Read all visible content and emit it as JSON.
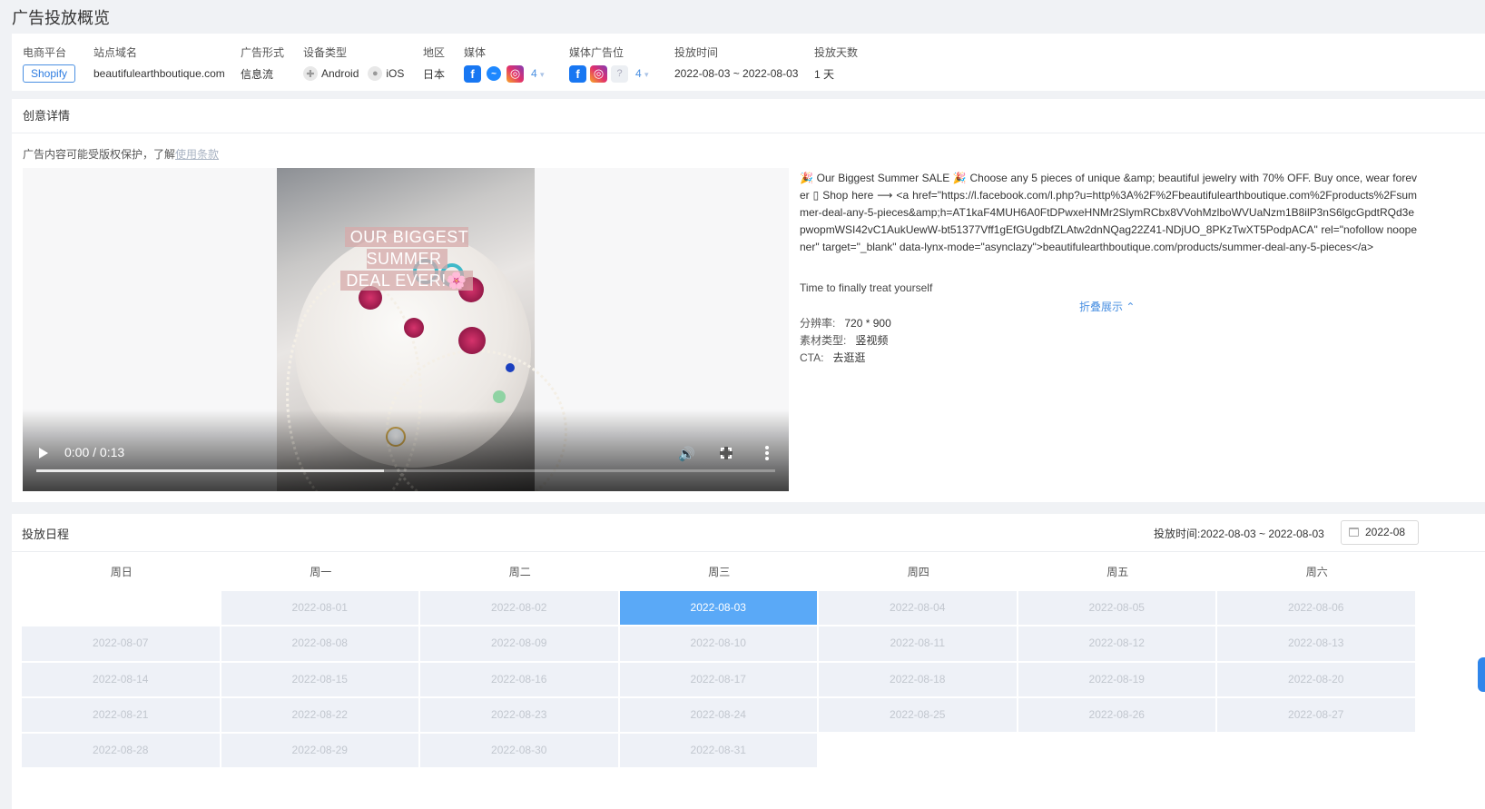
{
  "page_title": "广告投放概览",
  "overview": {
    "platform": {
      "label": "电商平台",
      "value": "Shopify"
    },
    "domain": {
      "label": "站点域名",
      "value": "beautifulearthboutique.com"
    },
    "ad_format": {
      "label": "广告形式",
      "value": "信息流"
    },
    "device": {
      "label": "设备类型",
      "android": "Android",
      "ios": "iOS"
    },
    "region": {
      "label": "地区",
      "value": "日本"
    },
    "media": {
      "label": "媒体",
      "icons": [
        "facebook-icon",
        "messenger-icon",
        "instagram-icon"
      ],
      "more": "4"
    },
    "placement": {
      "label": "媒体广告位",
      "icons": [
        "facebook-icon",
        "instagram-icon",
        "unknown-icon"
      ],
      "more": "4"
    },
    "time": {
      "label": "投放时间",
      "value": "2022-08-03 ~ 2022-08-03"
    },
    "days": {
      "label": "投放天数",
      "value": "1 天"
    }
  },
  "creative": {
    "title": "创意详情",
    "notice": "广告内容可能受版权保护，了解",
    "notice_link": "使用条款",
    "video": {
      "overlay_line1": "OUR BIGGEST SUMMER",
      "overlay_line2": "DEAL EVER!🌸",
      "time": "0:00 / 0:13",
      "progress": 0.47
    },
    "ad_text": "🎉 Our Biggest Summer SALE 🎉 Choose any 5 pieces of unique &amp; beautiful jewelry with 70% OFF. Buy once, wear forever ▯ Shop here ⟶ <a href=\"https://l.facebook.com/l.php?u=http%3A%2F%2Fbeautifulearthboutique.com%2Fproducts%2Fsummer-deal-any-5-pieces&amp;h=AT1kaF4MUH6A0FtDPwxeHNMr2SlymRCbx8VVohMzlboWVUaNzm1B8ilP3nS6lgcGpdtRQd3epwopmWSI42vC1AukUewW-bt51377Vff1gEfGUgdbfZLAtw2dnNQag22Z41-NDjUO_8PKzTwXT5PodpACA\" rel=\"nofollow noopener\" target=\"_blank\" data-lynx-mode=\"asynclazy\">beautifulearthboutique.com/products/summer-deal-any-5-pieces</a>",
    "subtext": "Time to finally treat yourself",
    "collapse_label": "折叠展示 ⌃",
    "resolution_label": "分辨率:",
    "resolution": "720 * 900",
    "material_label": "素材类型:",
    "material": "竖视频",
    "cta_label": "CTA:",
    "cta": "去逛逛"
  },
  "schedule": {
    "title": "投放日程",
    "range_label": "投放时间:",
    "range": "2022-08-03 ~ 2022-08-03",
    "month": "2022-08",
    "weekdays": [
      "周日",
      "周一",
      "周二",
      "周三",
      "周四",
      "周五",
      "周六"
    ],
    "active_date": "2022-08-03",
    "weeks": [
      [
        "",
        "2022-08-01",
        "2022-08-02",
        "2022-08-03",
        "2022-08-04",
        "2022-08-05",
        "2022-08-06"
      ],
      [
        "2022-08-07",
        "2022-08-08",
        "2022-08-09",
        "2022-08-10",
        "2022-08-11",
        "2022-08-12",
        "2022-08-13"
      ],
      [
        "2022-08-14",
        "2022-08-15",
        "2022-08-16",
        "2022-08-17",
        "2022-08-18",
        "2022-08-19",
        "2022-08-20"
      ],
      [
        "2022-08-21",
        "2022-08-22",
        "2022-08-23",
        "2022-08-24",
        "2022-08-25",
        "2022-08-26",
        "2022-08-27"
      ],
      [
        "2022-08-28",
        "2022-08-29",
        "2022-08-30",
        "2022-08-31",
        "",
        "",
        ""
      ]
    ]
  }
}
